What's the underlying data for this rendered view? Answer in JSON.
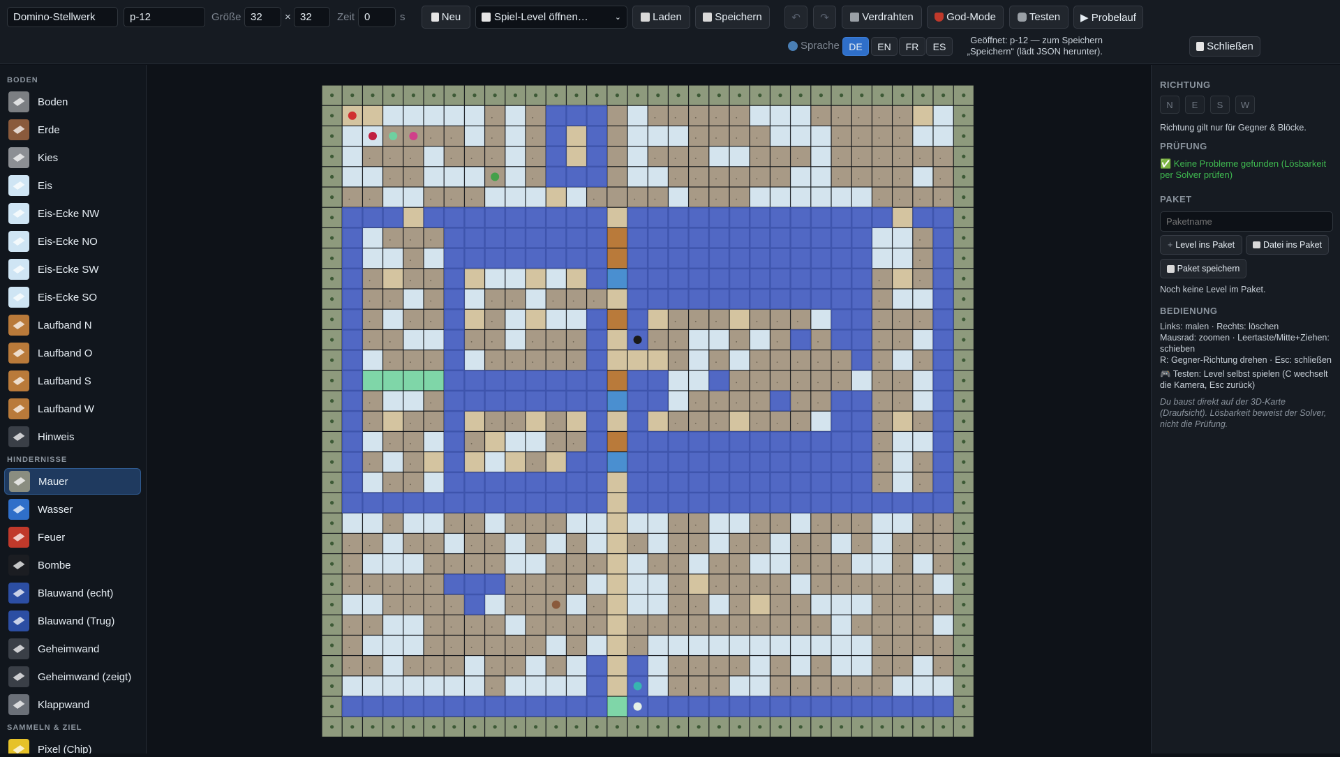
{
  "toolbar": {
    "level_name": "Domino-Stellwerk",
    "level_id": "p-12",
    "size_label": "Größe",
    "width": "32",
    "times": "×",
    "height": "32",
    "time_label": "Zeit",
    "time_value": "0",
    "time_unit": "s",
    "new_label": "Neu",
    "open_select": "Spiel-Level öffnen…",
    "load_label": "Laden",
    "save_label": "Speichern",
    "undo_icon": "↶",
    "redo_icon": "↷",
    "wire_label": "Verdrahten",
    "god_label": "God-Mode",
    "test_label": "Testen",
    "dryrun_label": "▶ Probelauf",
    "language_label": "Sprache",
    "languages": [
      "DE",
      "EN",
      "FR",
      "ES"
    ],
    "active_language": "DE",
    "status_text": "Geöffnet: p-12 — zum Speichern „Speichern“ (lädt JSON herunter).",
    "close_label": "Schließen"
  },
  "sidebar": {
    "sections": [
      {
        "title": "BODEN",
        "items": [
          {
            "label": "Boden",
            "color": "#7c7f83"
          },
          {
            "label": "Erde",
            "color": "#8a5a3c"
          },
          {
            "label": "Kies",
            "color": "#8c8f94"
          },
          {
            "label": "Eis",
            "color": "#cfe5f4"
          },
          {
            "label": "Eis-Ecke NW",
            "color": "#cfe5f4"
          },
          {
            "label": "Eis-Ecke NO",
            "color": "#cfe5f4"
          },
          {
            "label": "Eis-Ecke SW",
            "color": "#cfe5f4"
          },
          {
            "label": "Eis-Ecke SO",
            "color": "#cfe5f4"
          },
          {
            "label": "Laufband N",
            "color": "#b97a3a"
          },
          {
            "label": "Laufband O",
            "color": "#b97a3a"
          },
          {
            "label": "Laufband S",
            "color": "#b97a3a"
          },
          {
            "label": "Laufband W",
            "color": "#b97a3a"
          },
          {
            "label": "Hinweis",
            "color": "#3a3f47"
          }
        ]
      },
      {
        "title": "HINDERNISSE",
        "items": [
          {
            "label": "Mauer",
            "color": "#8a8d80",
            "selected": true
          },
          {
            "label": "Wasser",
            "color": "#2f6fc9"
          },
          {
            "label": "Feuer",
            "color": "#c0392b"
          },
          {
            "label": "Bombe",
            "color": "#1b1d22"
          },
          {
            "label": "Blauwand (echt)",
            "color": "#2c4ea3"
          },
          {
            "label": "Blauwand (Trug)",
            "color": "#2c4ea3"
          },
          {
            "label": "Geheimwand",
            "color": "#3a3f47"
          },
          {
            "label": "Geheimwand (zeigt)",
            "color": "#3a3f47"
          },
          {
            "label": "Klappwand",
            "color": "#6b7078"
          }
        ]
      },
      {
        "title": "SAMMELN & ZIEL",
        "items": [
          {
            "label": "Pixel (Chip)",
            "color": "#e6c229"
          }
        ]
      }
    ]
  },
  "right_panel": {
    "direction_title": "RICHTUNG",
    "directions": [
      "N",
      "E",
      "S",
      "W"
    ],
    "direction_note": "Richtung gilt nur für Gegner & Blöcke.",
    "check_title": "PRÜFUNG",
    "check_result": "✅ Keine Probleme gefunden (Lösbarkeit per Solver prüfen)",
    "package_title": "PAKET",
    "package_placeholder": "Paketname",
    "add_level_label": "Level ins Paket",
    "add_file_label": "Datei ins Paket",
    "save_package_label": "Paket speichern",
    "package_empty": "Noch keine Level im Paket.",
    "controls_title": "BEDIENUNG",
    "controls": [
      "Links: malen · Rechts: löschen",
      "Mausrad: zoomen · Leertaste/Mitte+Ziehen: schieben",
      "R: Gegner-Richtung drehen · Esc: schließen",
      "🎮 Testen: Level selbst spielen (C wechselt die Kamera, Esc zurück)"
    ],
    "note": "Du baust direkt auf der 3D-Karte (Draufsicht). Lösbarkeit beweist der Solver, nicht die Prüfung."
  },
  "map": {
    "colors": {
      "wall": "#8e9a7d",
      "floor": "#a89a86",
      "ice": "#d4e4ee",
      "water": "#5168c4",
      "sand": "#d4c4a0",
      "conveyor": "#b97a3a",
      "conv_blue": "#4a8fd0",
      "green": "#7fd6a8"
    },
    "rows": [
      "WWWWWWWWWWWWWWWWWWWWWWWWWWWWWWWW",
      "WssIIIIIFIFAAASIFFFFFIIIFFFFFsIW",
      "WIIFFFFIFIFAsASIIIFFFFIIIFFFFIIW",
      "WIFFFIFFFIFAsASIFFFIIFFFIFFFFFFW",
      "WIIFFIIIFIFAAASIIFFFFFFIIFFFFIFW",
      "WFFIIFFFIIIsIFSFFIFFFIIIIIIFFFFW",
      "WAAAsAAAAAAAAAsAAAAAAAAAAAAAsAAW",
      "WAIFFFAAAAAAAAcAAAAAAAAAAAAIIFAW",
      "WAIIFIAAAAAAAAcAAAAAAAAAAAAIIFAW",
      "WAFsFFAsIIsIsAbAAAAAAAAAAAAFsFAW",
      "WAFFIFAIFFIFFFsAAAAAAAAAAAAFIIAW",
      "WAFIFFAsFIsIIAcAsFFFsFFFIAAFFFAW",
      "WAFFIIAFFIFFFAsAFFIIFIFAFAAFFIAW",
      "WAIFFFAIFFFFFAsssFIFIFFFFFAFIFAW",
      "WAggggAAAAAAAAcAAIIAFFFFFFIFFIAW",
      "WAFIIFAAAAAAAAbAAIFFFFAFFAAFFIAW",
      "WAFsFFAsFFsFsAsAsFFFsFFFIAAFsFAW",
      "WAIFFIAFsIIFFAcAAAAAAAAAAAAFIIAW",
      "WAFIFsAsIsFsAAbAAAAAAAAAAAAFIFAW",
      "WAIFFIAAAAAAAAsAAAAAAAAAAAAFIFAW",
      "WAAAAAAAAAAAAAsAAAAAAAAAAAAAAAAW",
      "WIIFIIFFIFFFIIsIIFFIIFFIFFFIIFFW",
      "WFFIFFIFFIFIFIsFIFFIFFIFFIFIFFFW",
      "WFIIIFFFFIIFFFsIFFIFFIIFFFIIFIFW",
      "WFFFFFAAAFFFFIsIIFsFFFFIFFFFFFIW",
      "WIIFFFFAIFFFIFsIIFFIFsFFIIIFFFFW",
      "WFFIIFFFFIFFFFsFFFFFFFFFFIFFFFIW",
      "WFIIIFFFFFFIFIsFIIIIIIIIIIIFFFFW",
      "WFFIFFFIFFIFIAsAIFFFFIFIFIIFFIFW",
      "WIIIIIIIFIIIIAsAIFFFIIFFFFFFIIIW",
      "WAAAAAAAAAAAAAgAAAAAAAAAAAAAAAAW",
      "WWWWWWWWWWWWWWWWWWWWWWWWWWWWWWWW"
    ]
  }
}
